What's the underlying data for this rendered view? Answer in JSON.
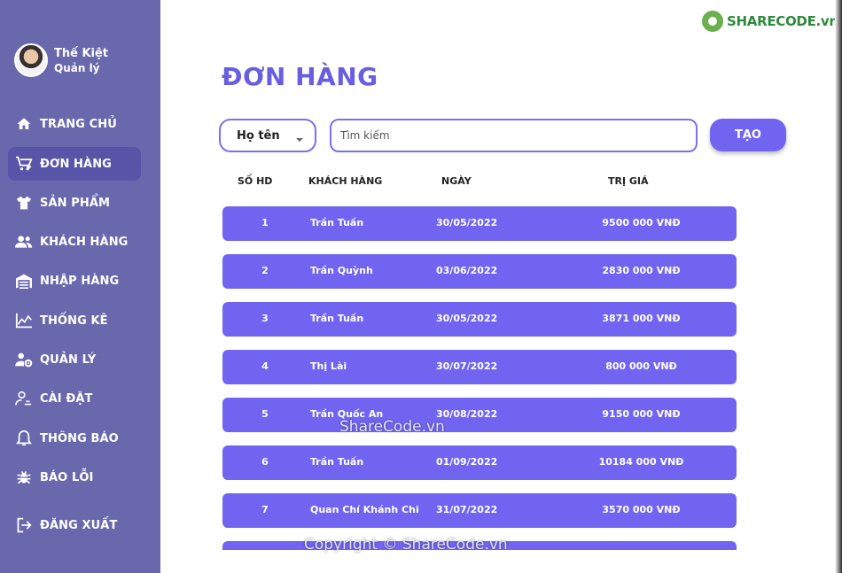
{
  "profile": {
    "name": "Thế Kiệt",
    "role": "Quản lý"
  },
  "nav": [
    {
      "label": "TRANG CHỦ",
      "icon": "home-icon"
    },
    {
      "label": "ĐƠN HÀNG",
      "icon": "cart-icon",
      "active": true
    },
    {
      "label": "SẢN PHẨM",
      "icon": "shirt-icon"
    },
    {
      "label": "KHÁCH HÀNG",
      "icon": "people-icon"
    },
    {
      "label": "NHẬP HÀNG",
      "icon": "warehouse-icon"
    },
    {
      "label": "THỐNG KÊ",
      "icon": "chart-icon"
    },
    {
      "label": "QUẢN LÝ",
      "icon": "user-gear-icon"
    },
    {
      "label": "CÀI ĐẶT",
      "icon": "user-settings-icon"
    },
    {
      "label": "THÔNG BÁO",
      "icon": "bell-icon"
    },
    {
      "label": "BÁO LỖI",
      "icon": "bug-icon"
    },
    {
      "label": "ĐĂNG XUẤT",
      "icon": "logout-icon"
    }
  ],
  "page_title": "ĐƠN HÀNG",
  "filter": {
    "selected": "Họ tên"
  },
  "search": {
    "placeholder": "Tìm kiếm"
  },
  "create_label": "TẠO",
  "table": {
    "headers": {
      "id": "SỐ HD",
      "customer": "KHÁCH HÀNG",
      "date": "NGÀY",
      "value": "TRỊ GIÁ"
    },
    "rows": [
      {
        "id": "1",
        "customer": "Trần Tuấn",
        "date": "30/05/2022",
        "value": "9500 000 VNĐ"
      },
      {
        "id": "2",
        "customer": "Trần Quỳnh",
        "date": "03/06/2022",
        "value": "2830 000 VNĐ"
      },
      {
        "id": "3",
        "customer": "Trần Tuấn",
        "date": "30/05/2022",
        "value": "3871 000 VNĐ"
      },
      {
        "id": "4",
        "customer": "Thị Lài",
        "date": "30/07/2022",
        "value": "800 000 VNĐ"
      },
      {
        "id": "5",
        "customer": "Trần Quốc An",
        "date": "30/08/2022",
        "value": "9150 000 VNĐ"
      },
      {
        "id": "6",
        "customer": "Trần Tuấn",
        "date": "01/09/2022",
        "value": "10184 000 VNĐ"
      },
      {
        "id": "7",
        "customer": "Quan Chí Khánh Chi",
        "date": "31/07/2022",
        "value": "3570 000 VNĐ"
      },
      {
        "id": "",
        "customer": "",
        "date": "",
        "value": ""
      }
    ]
  },
  "watermark": {
    "logo_text": "SHARECODE.vn",
    "center_text": "ShareCode.vn",
    "bottom_text": "Copyright © ShareCode.vn"
  },
  "colors": {
    "sidebar": "#6a68ad",
    "accent": "#7164f0",
    "title": "#6a5ee0"
  }
}
